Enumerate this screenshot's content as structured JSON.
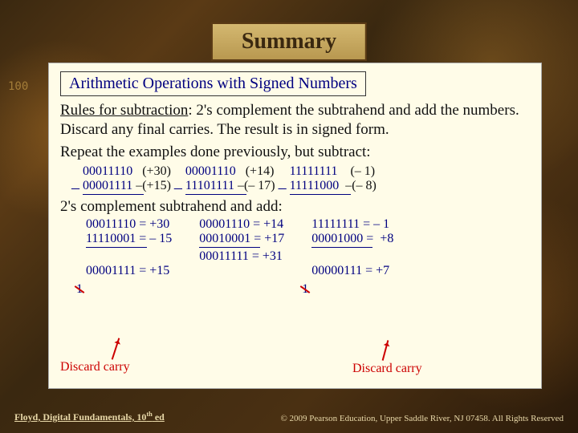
{
  "title": "Summary",
  "subtitle": "Arithmetic Operations with Signed Numbers",
  "rules_text_1": "Rules for subtraction",
  "rules_text_2": ": 2's complement the subtrahend and add the numbers. Discard any final carries. The result is in signed form.",
  "repeat_text": "Repeat the examples done previously, but subtract:",
  "sub_examples": [
    {
      "top_bin": "00011110",
      "top_dec": "(+30)",
      "bot_bin": "00001111",
      "bot_dec": "–(+15)"
    },
    {
      "top_bin": "00001110",
      "top_dec": "(+14)",
      "bot_bin": "11101111",
      "bot_dec": "–(– 17)"
    },
    {
      "top_bin": "11111111",
      "top_dec": "(– 1)",
      "bot_bin": "11111000",
      "bot_dec": "–(– 8)"
    }
  ],
  "complement_text": "2's complement subtrahend and add:",
  "add_examples": [
    {
      "r1": "00011110 = +30",
      "r2": "11110001 = – 15",
      "r3": "00001111 = +15",
      "carry": "1"
    },
    {
      "r1": "00001110 = +14",
      "r2": "00010001 = +17",
      "r3": "00011111 = +31",
      "carry": ""
    },
    {
      "r1": "11111111 = – 1",
      "r2": "00001000 =  +8",
      "r3": "00000111 = +7",
      "carry": "1"
    }
  ],
  "discard_label": "Discard carry",
  "footer_left_a": "Floyd, Digital Fundamentals, 10",
  "footer_left_b": "th",
  "footer_left_c": " ed",
  "footer_right": "© 2009 Pearson Education, Upper Saddle River, NJ 07458. All Rights Reserved"
}
